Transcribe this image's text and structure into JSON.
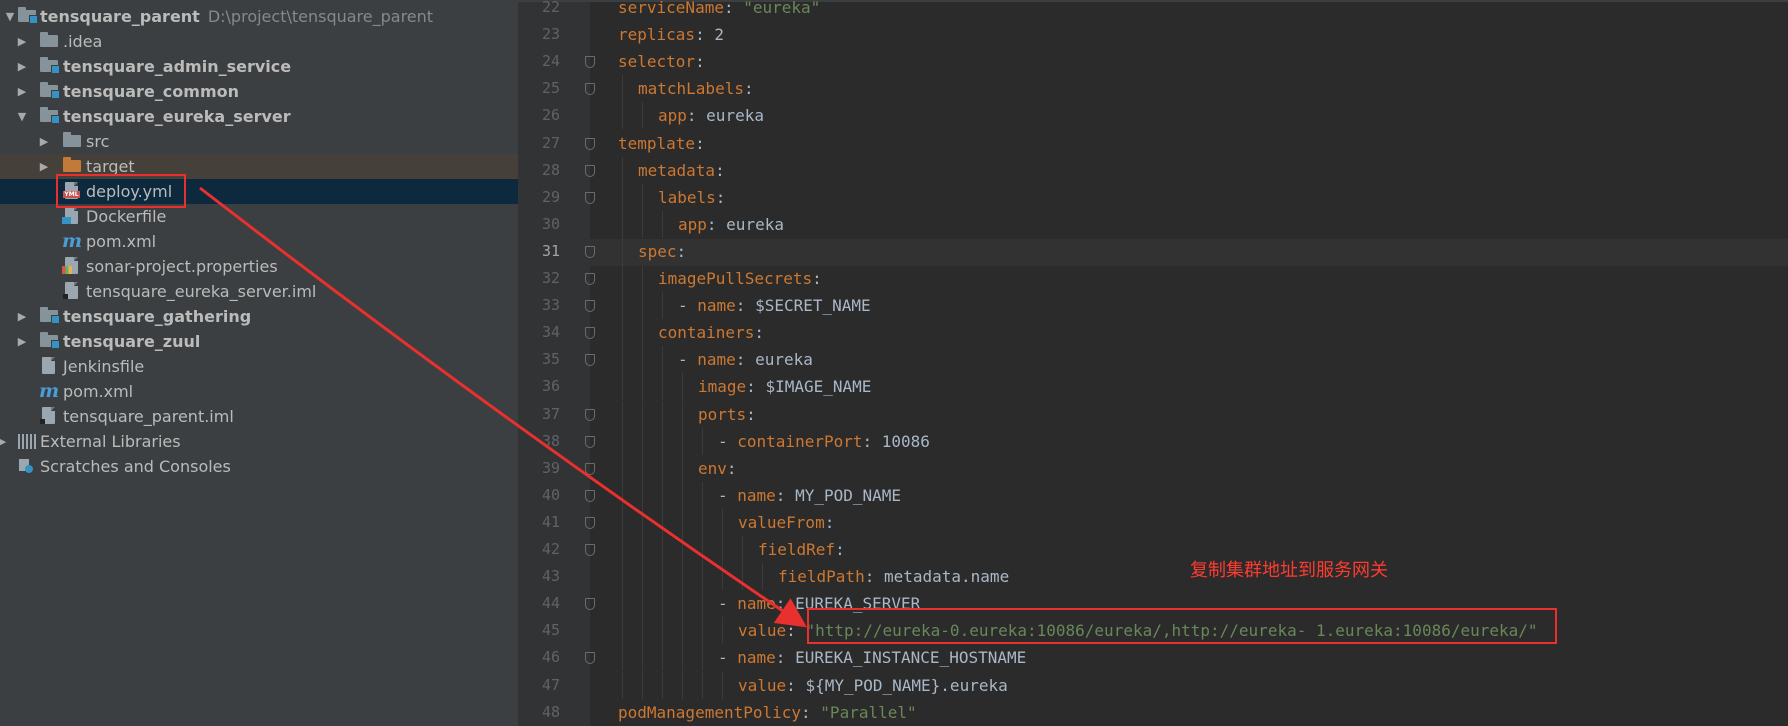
{
  "tree": {
    "root": {
      "label": "tensquare_parent",
      "path": "D:\\project\\tensquare_parent"
    },
    "items": [
      {
        "label": ".idea"
      },
      {
        "label": "tensquare_admin_service"
      },
      {
        "label": "tensquare_common"
      },
      {
        "label": "tensquare_eureka_server"
      },
      {
        "label": "src"
      },
      {
        "label": "target"
      },
      {
        "label": "deploy.yml"
      },
      {
        "label": "Dockerfile"
      },
      {
        "label": "pom.xml"
      },
      {
        "label": "sonar-project.properties"
      },
      {
        "label": "tensquare_eureka_server.iml"
      },
      {
        "label": "tensquare_gathering"
      },
      {
        "label": "tensquare_zuul"
      },
      {
        "label": "Jenkinsfile"
      },
      {
        "label": "pom.xml"
      },
      {
        "label": "tensquare_parent.iml"
      },
      {
        "label": "External Libraries"
      },
      {
        "label": "Scratches and Consoles"
      }
    ]
  },
  "editor": {
    "current_line": "31",
    "lines": [
      {
        "n": "22",
        "indent": 0,
        "key": "serviceName",
        "sep": ": ",
        "val": "\"eureka\"",
        "vtype": "s"
      },
      {
        "n": "23",
        "indent": 0,
        "key": "replicas",
        "sep": ": ",
        "val": "2",
        "vtype": "v"
      },
      {
        "n": "24",
        "indent": 0,
        "key": "selector",
        "sep": ":",
        "val": "",
        "vtype": "v"
      },
      {
        "n": "25",
        "indent": 1,
        "key": "matchLabels",
        "sep": ":",
        "val": "",
        "vtype": "v"
      },
      {
        "n": "26",
        "indent": 2,
        "key": "app",
        "sep": ": ",
        "val": "eureka",
        "vtype": "v"
      },
      {
        "n": "27",
        "indent": 0,
        "key": "template",
        "sep": ":",
        "val": "",
        "vtype": "v"
      },
      {
        "n": "28",
        "indent": 1,
        "key": "metadata",
        "sep": ":",
        "val": "",
        "vtype": "v"
      },
      {
        "n": "29",
        "indent": 2,
        "key": "labels",
        "sep": ":",
        "val": "",
        "vtype": "v"
      },
      {
        "n": "30",
        "indent": 3,
        "key": "app",
        "sep": ": ",
        "val": "eureka",
        "vtype": "v"
      },
      {
        "n": "31",
        "indent": 1,
        "key": "spec",
        "sep": ":",
        "val": "",
        "vtype": "v"
      },
      {
        "n": "32",
        "indent": 2,
        "key": "imagePullSecrets",
        "sep": ":",
        "val": "",
        "vtype": "v"
      },
      {
        "n": "33",
        "indent": 3,
        "dash": true,
        "key": "name",
        "sep": ": ",
        "val": "$SECRET_NAME",
        "vtype": "v"
      },
      {
        "n": "34",
        "indent": 2,
        "key": "containers",
        "sep": ":",
        "val": "",
        "vtype": "v"
      },
      {
        "n": "35",
        "indent": 3,
        "dash": true,
        "key": "name",
        "sep": ": ",
        "val": "eureka",
        "vtype": "v"
      },
      {
        "n": "36",
        "indent": 4,
        "key": "image",
        "sep": ": ",
        "val": "$IMAGE_NAME",
        "vtype": "v"
      },
      {
        "n": "37",
        "indent": 4,
        "key": "ports",
        "sep": ":",
        "val": "",
        "vtype": "v"
      },
      {
        "n": "38",
        "indent": 5,
        "dash": true,
        "key": "containerPort",
        "sep": ": ",
        "val": "10086",
        "vtype": "v"
      },
      {
        "n": "39",
        "indent": 4,
        "key": "env",
        "sep": ":",
        "val": "",
        "vtype": "v"
      },
      {
        "n": "40",
        "indent": 5,
        "dash": true,
        "key": "name",
        "sep": ": ",
        "val": "MY_POD_NAME",
        "vtype": "v"
      },
      {
        "n": "41",
        "indent": 6,
        "key": "valueFrom",
        "sep": ":",
        "val": "",
        "vtype": "v"
      },
      {
        "n": "42",
        "indent": 7,
        "key": "fieldRef",
        "sep": ":",
        "val": "",
        "vtype": "v"
      },
      {
        "n": "43",
        "indent": 8,
        "key": "fieldPath",
        "sep": ": ",
        "val": "metadata.name",
        "vtype": "v"
      },
      {
        "n": "44",
        "indent": 5,
        "dash": true,
        "key": "name",
        "sep": ": ",
        "val": "EUREKA_SERVER",
        "vtype": "v"
      },
      {
        "n": "45",
        "indent": 6,
        "key": "value",
        "sep": ": ",
        "val": "\"http://eureka-0.eureka:10086/eureka/,http://eureka- 1.eureka:10086/eureka/\"",
        "vtype": "s"
      },
      {
        "n": "46",
        "indent": 5,
        "dash": true,
        "key": "name",
        "sep": ": ",
        "val": "EUREKA_INSTANCE_HOSTNAME",
        "vtype": "v"
      },
      {
        "n": "47",
        "indent": 6,
        "key": "value",
        "sep": ": ",
        "val": "${MY_POD_NAME}.eureka",
        "vtype": "v"
      },
      {
        "n": "48",
        "indent": 0,
        "key": "podManagementPolicy",
        "sep": ": ",
        "val": "\"Parallel\"",
        "vtype": "s"
      }
    ]
  },
  "annotation": {
    "note": "复制集群地址到服务网关",
    "color": "#e8302e"
  },
  "colors": {
    "tree_bg": "#3c3f41",
    "editor_bg": "#2b2b2b",
    "key": "#cc7832",
    "string": "#6a8759",
    "text": "#a9b7c6",
    "selection": "#0d293e"
  },
  "icons": [
    "folder-icon",
    "module-folder-icon",
    "yml-file-icon",
    "docker-file-icon",
    "maven-icon",
    "properties-file-icon",
    "iml-file-icon",
    "jenkins-file-icon",
    "libraries-icon",
    "scratches-icon"
  ]
}
